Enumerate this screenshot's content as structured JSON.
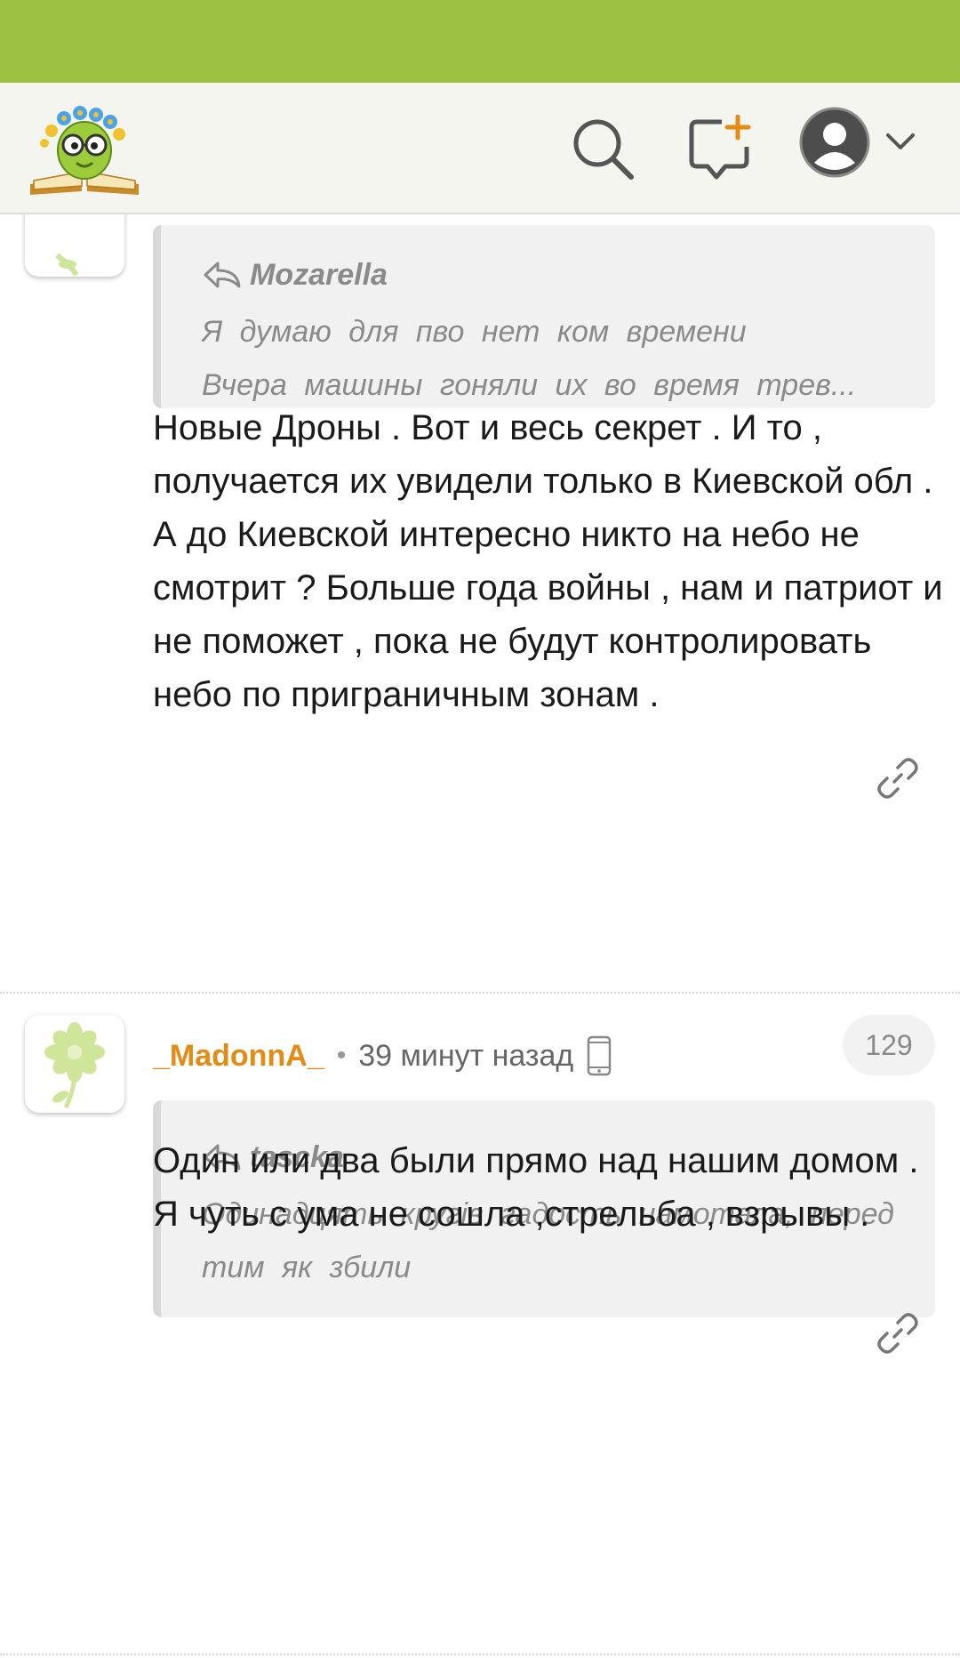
{
  "header": {
    "logo_icon": "bookworm-logo",
    "search_icon": "search-icon",
    "new_post_icon": "add-comment-icon",
    "avatar_icon": "user-avatar-icon",
    "avatar_menu_icon": "chevron-down-icon"
  },
  "comments": [
    {
      "quote": {
        "author": "Mozarella",
        "lines": [
          "Я думаю для пво нет ком времени",
          "Вчера машины гоняли их во время трев..."
        ]
      },
      "text": "Новые Дроны . Вот и весь секрет . И то , получается их увидели только в Киевской обл . А до Киевской интересно никто на небо не смотрит ? Больше года войны , нам и патриот и не поможет , пока не будут контролировать небо по приграничным зонам .",
      "link_icon": "link-icon"
    },
    {
      "username": "_MadonnA_",
      "separator": "•",
      "time": "39 минут назад",
      "device_icon": "mobile-phone-icon",
      "likes": "129",
      "quote": {
        "author": "tascka",
        "lines": [
          "Одинадцять кругів гадость намотала, перед",
          "тим як збили"
        ]
      },
      "text": "Один или два были прямо над нашим домом . Я чуть с ума не сошла ,стрельба , взрывы .",
      "link_icon": "link-icon"
    }
  ],
  "colors": {
    "status_bar": "#9dc243",
    "username": "#e58a12",
    "quote_text": "#8a8a8a"
  }
}
